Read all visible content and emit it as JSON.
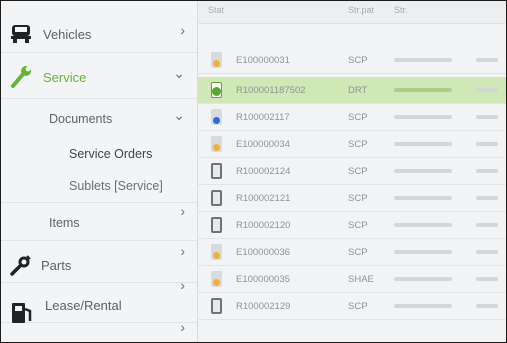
{
  "sidebar": {
    "items": [
      {
        "label": "Vehicles",
        "icon": "vehicle-icon",
        "chevron": "›"
      },
      {
        "label": "Service",
        "icon": "wrench-icon",
        "chevron": "⌄",
        "active": true
      },
      {
        "label": "Documents",
        "chevron": "⌄"
      },
      {
        "label": "Service Orders"
      },
      {
        "label": "Sublets [Service]"
      },
      {
        "label": "Items",
        "chevron": "›"
      },
      {
        "label": "Parts",
        "icon": "parts-icon",
        "chevron": "›"
      },
      {
        "label": "Lease/Rental",
        "icon": "fuel-pump-icon",
        "chevron": "›"
      }
    ],
    "colors": {
      "active": "#68b33a"
    }
  },
  "table": {
    "headers": [
      "Stat",
      "Str.pat",
      "Str."
    ],
    "rows": [
      {
        "id": "E100000031",
        "type": "SCP",
        "status": "pending",
        "color": "#f2b134"
      },
      {
        "id": "R100001187502",
        "type": "DRT",
        "status": "open",
        "color": "#58a531",
        "selected": true
      },
      {
        "id": "R100002117",
        "type": "SCP",
        "status": "checked",
        "color": "#2f6bd6"
      },
      {
        "id": "E100000034",
        "type": "SCP",
        "status": "pending",
        "color": "#f2b134"
      },
      {
        "id": "R100002124",
        "type": "SCP",
        "status": "document",
        "color": "#6d7378"
      },
      {
        "id": "R100002121",
        "type": "SCP",
        "status": "document",
        "color": "#6d7378"
      },
      {
        "id": "R100002120",
        "type": "SCP",
        "status": "document",
        "color": "#6d7378"
      },
      {
        "id": "E100000036",
        "type": "SCP",
        "status": "pending",
        "color": "#f2b134"
      },
      {
        "id": "E100000035",
        "type": "SHAE",
        "status": "pending",
        "color": "#f2b134"
      },
      {
        "id": "R100002129",
        "type": "SCP",
        "status": "document",
        "color": "#6d7378"
      }
    ]
  }
}
